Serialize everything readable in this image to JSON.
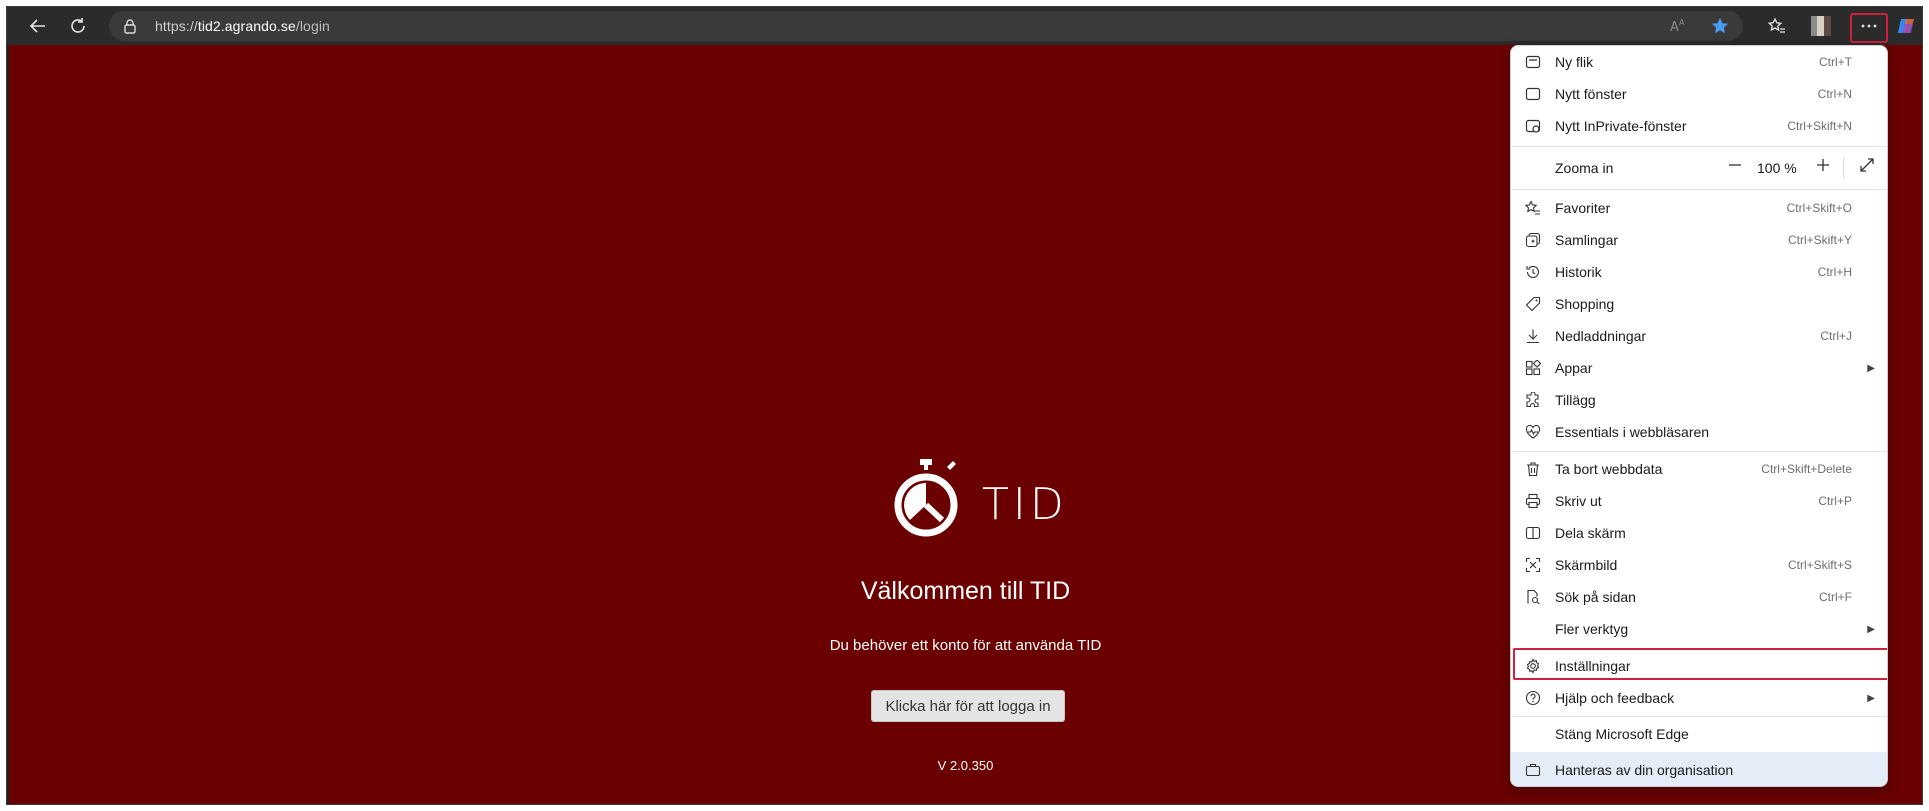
{
  "browser": {
    "url_prefix": "https://",
    "url_host": "tid2.agrando.se",
    "url_path": "/login"
  },
  "page": {
    "brand": "TID",
    "welcome": "Välkommen till TID",
    "subtitle": "Du behöver ett konto för att använda TID",
    "login_button": "Klicka här för att logga in",
    "version": "V 2.0.350",
    "background_color": "#6b0000"
  },
  "menu": {
    "items": [
      {
        "label": "Ny flik",
        "shortcut": "Ctrl+T",
        "icon": "new-tab-icon"
      },
      {
        "label": "Nytt fönster",
        "shortcut": "Ctrl+N",
        "icon": "new-window-icon"
      },
      {
        "label": "Nytt InPrivate-fönster",
        "shortcut": "Ctrl+Skift+N",
        "icon": "inprivate-icon"
      },
      {
        "label": "Zooma in",
        "shortcut": "",
        "icon": ""
      },
      {
        "label": "Favoriter",
        "shortcut": "Ctrl+Skift+O",
        "icon": "favorites-icon"
      },
      {
        "label": "Samlingar",
        "shortcut": "Ctrl+Skift+Y",
        "icon": "collections-icon"
      },
      {
        "label": "Historik",
        "shortcut": "Ctrl+H",
        "icon": "history-icon"
      },
      {
        "label": "Shopping",
        "shortcut": "",
        "icon": "shopping-tag-icon"
      },
      {
        "label": "Nedladdningar",
        "shortcut": "Ctrl+J",
        "icon": "download-icon"
      },
      {
        "label": "Appar",
        "shortcut": "",
        "icon": "apps-icon"
      },
      {
        "label": "Tillägg",
        "shortcut": "",
        "icon": "extensions-icon"
      },
      {
        "label": "Essentials i webbläsaren",
        "shortcut": "",
        "icon": "heart-pulse-icon"
      },
      {
        "label": "Ta bort webbdata",
        "shortcut": "Ctrl+Skift+Delete",
        "icon": "trash-icon"
      },
      {
        "label": "Skriv ut",
        "shortcut": "Ctrl+P",
        "icon": "print-icon"
      },
      {
        "label": "Dela skärm",
        "shortcut": "",
        "icon": "split-screen-icon"
      },
      {
        "label": "Skärmbild",
        "shortcut": "Ctrl+Skift+S",
        "icon": "screenshot-icon"
      },
      {
        "label": "Sök på sidan",
        "shortcut": "Ctrl+F",
        "icon": "find-icon"
      },
      {
        "label": "Fler verktyg",
        "shortcut": "",
        "icon": ""
      },
      {
        "label": "Inställningar",
        "shortcut": "",
        "icon": "gear-icon"
      },
      {
        "label": "Hjälp och feedback",
        "shortcut": "",
        "icon": "help-icon"
      },
      {
        "label": "Stäng Microsoft Edge",
        "shortcut": "",
        "icon": ""
      },
      {
        "label": "Hanteras av din organisation",
        "shortcut": "",
        "icon": "briefcase-icon"
      }
    ],
    "zoom_value": "100 %",
    "highlight_color": "#d11f3f"
  }
}
